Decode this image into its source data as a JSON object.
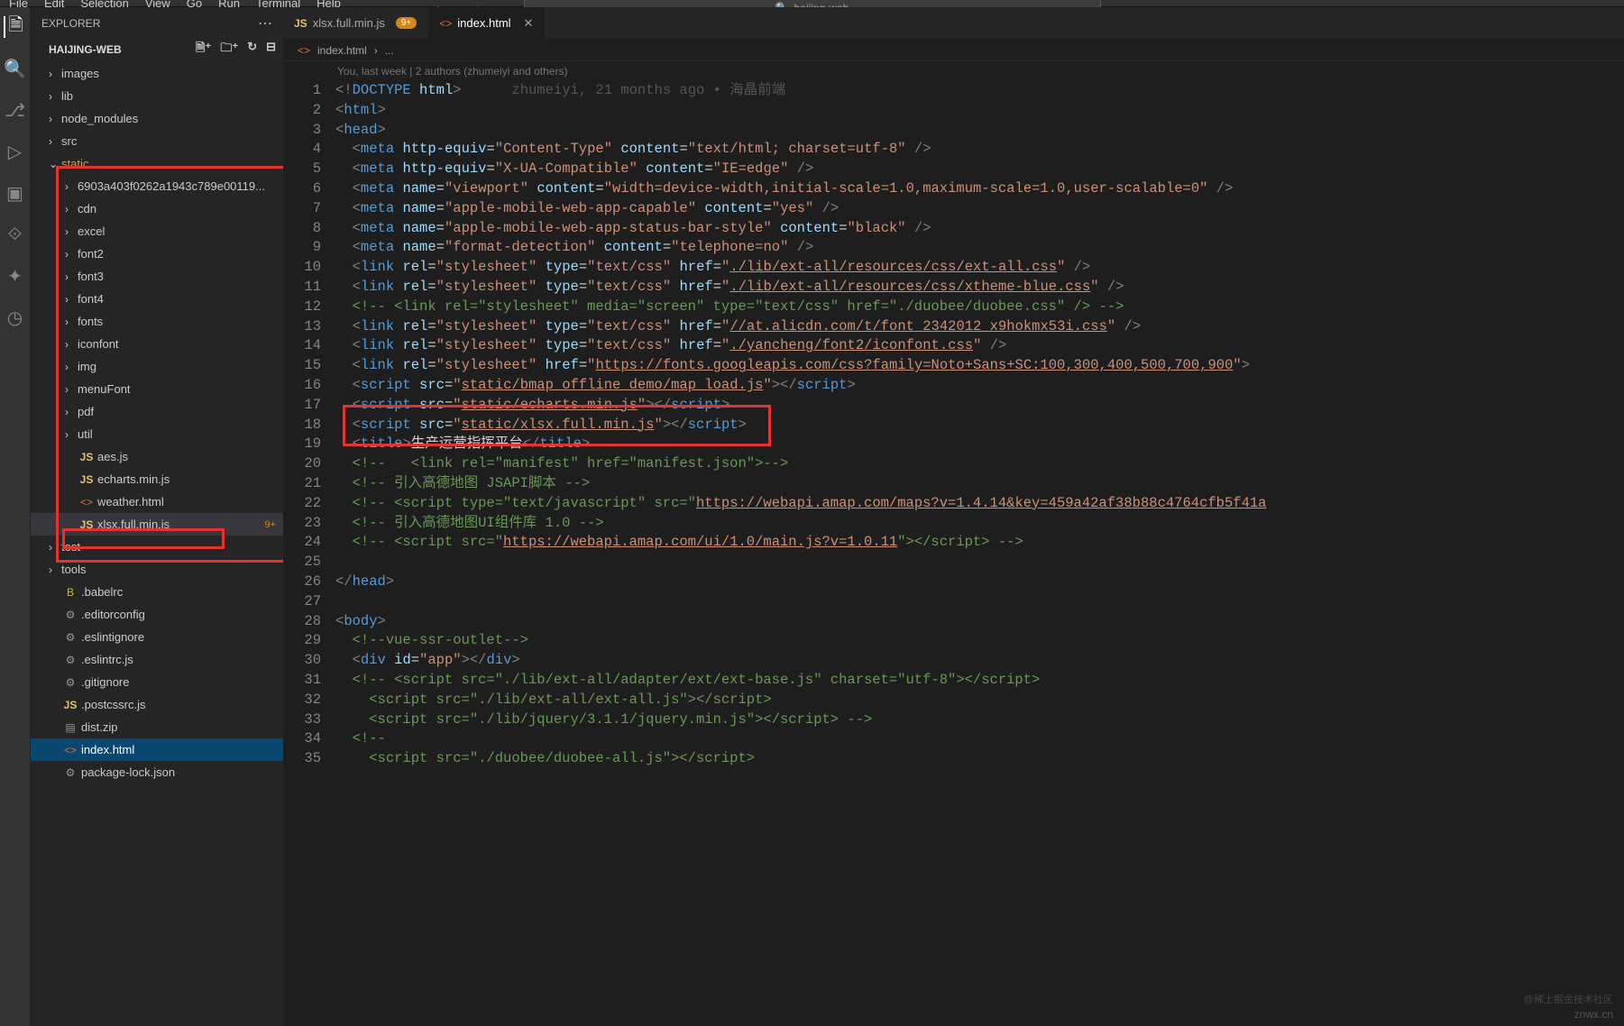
{
  "menubar": {
    "items": [
      "File",
      "Edit",
      "Selection",
      "View",
      "Go",
      "Run",
      "Terminal",
      "Help"
    ],
    "search_text": "haijing-web"
  },
  "explorer": {
    "title": "EXPLORER",
    "project": "HAIJING-WEB"
  },
  "tree": [
    {
      "type": "folder",
      "label": "images",
      "depth": 1,
      "open": false
    },
    {
      "type": "folder",
      "label": "lib",
      "depth": 1,
      "open": false
    },
    {
      "type": "folder",
      "label": "node_modules",
      "depth": 1,
      "open": false
    },
    {
      "type": "folder",
      "label": "src",
      "depth": 1,
      "open": false
    },
    {
      "type": "folder",
      "label": "static",
      "depth": 1,
      "open": true,
      "orange": true
    },
    {
      "type": "folder",
      "label": "6903a403f0262a1943c789e00119...",
      "depth": 2,
      "open": false
    },
    {
      "type": "folder",
      "label": "cdn",
      "depth": 2,
      "open": false
    },
    {
      "type": "folder",
      "label": "excel",
      "depth": 2,
      "open": false
    },
    {
      "type": "folder",
      "label": "font2",
      "depth": 2,
      "open": false
    },
    {
      "type": "folder",
      "label": "font3",
      "depth": 2,
      "open": false
    },
    {
      "type": "folder",
      "label": "font4",
      "depth": 2,
      "open": false
    },
    {
      "type": "folder",
      "label": "fonts",
      "depth": 2,
      "open": false
    },
    {
      "type": "folder",
      "label": "iconfont",
      "depth": 2,
      "open": false
    },
    {
      "type": "folder",
      "label": "img",
      "depth": 2,
      "open": false
    },
    {
      "type": "folder",
      "label": "menuFont",
      "depth": 2,
      "open": false
    },
    {
      "type": "folder",
      "label": "pdf",
      "depth": 2,
      "open": false
    },
    {
      "type": "folder",
      "label": "util",
      "depth": 2,
      "open": false
    },
    {
      "type": "file",
      "label": "aes.js",
      "depth": 2,
      "icon": "js"
    },
    {
      "type": "file",
      "label": "echarts.min.js",
      "depth": 2,
      "icon": "js"
    },
    {
      "type": "file",
      "label": "weather.html",
      "depth": 2,
      "icon": "html"
    },
    {
      "type": "file",
      "label": "xlsx.full.min.js",
      "depth": 2,
      "icon": "js",
      "badge": "9+",
      "selected": true
    },
    {
      "type": "folder",
      "label": "test",
      "depth": 1,
      "open": false
    },
    {
      "type": "folder",
      "label": "tools",
      "depth": 1,
      "open": false
    },
    {
      "type": "file",
      "label": ".babelrc",
      "depth": 1,
      "icon": "babel"
    },
    {
      "type": "file",
      "label": ".editorconfig",
      "depth": 1,
      "icon": "cfg"
    },
    {
      "type": "file",
      "label": ".eslintignore",
      "depth": 1,
      "icon": "cfg"
    },
    {
      "type": "file",
      "label": ".eslintrc.js",
      "depth": 1,
      "icon": "cfg"
    },
    {
      "type": "file",
      "label": ".gitignore",
      "depth": 1,
      "icon": "cfg"
    },
    {
      "type": "file",
      "label": ".postcssrc.js",
      "depth": 1,
      "icon": "js"
    },
    {
      "type": "file",
      "label": "dist.zip",
      "depth": 1,
      "icon": "zip"
    },
    {
      "type": "file",
      "label": "index.html",
      "depth": 1,
      "icon": "html",
      "focused": true
    },
    {
      "type": "file",
      "label": "package-lock.json",
      "depth": 1,
      "icon": "cfg"
    }
  ],
  "tabs": [
    {
      "icon": "js",
      "label": "xlsx.full.min.js",
      "badge": "9+",
      "active": false
    },
    {
      "icon": "html",
      "label": "index.html",
      "active": true,
      "close": true
    }
  ],
  "breadcrumb": {
    "file": "index.html",
    "rest": "..."
  },
  "blame": "You, last week | 2 authors (zhumeiyi and others)",
  "codelens": "zhumeiyi, 21 months ago • 海晶前端",
  "code_lines": [
    {
      "n": 1,
      "html": "<span class='t-punc'>&lt;!</span><span class='t-tag'>DOCTYPE</span> <span class='t-attr'>html</span><span class='t-punc'>&gt;</span>      <span class='t-dim'>zhumeiyi, 21 months ago • 海晶前端</span>"
    },
    {
      "n": 2,
      "html": "<span class='t-punc'>&lt;</span><span class='t-tag'>html</span><span class='t-punc'>&gt;</span>"
    },
    {
      "n": 3,
      "html": "<span class='t-punc'>&lt;</span><span class='t-tag'>head</span><span class='t-punc'>&gt;</span>"
    },
    {
      "n": 4,
      "html": "  <span class='t-punc'>&lt;</span><span class='t-tag'>meta</span> <span class='t-attr'>http-equiv</span>=<span class='t-str'>\"Content-Type\"</span> <span class='t-attr'>content</span>=<span class='t-str'>\"text/html; charset=utf-8\"</span> <span class='t-punc'>/&gt;</span>"
    },
    {
      "n": 5,
      "html": "  <span class='t-punc'>&lt;</span><span class='t-tag'>meta</span> <span class='t-attr'>http-equiv</span>=<span class='t-str'>\"X-UA-Compatible\"</span> <span class='t-attr'>content</span>=<span class='t-str'>\"IE=edge\"</span> <span class='t-punc'>/&gt;</span>"
    },
    {
      "n": 6,
      "html": "  <span class='t-punc'>&lt;</span><span class='t-tag'>meta</span> <span class='t-attr'>name</span>=<span class='t-str'>\"viewport\"</span> <span class='t-attr'>content</span>=<span class='t-str'>\"width=device-width,initial-scale=1.0,maximum-scale=1.0,user-scalable=0\"</span> <span class='t-punc'>/&gt;</span>"
    },
    {
      "n": 7,
      "html": "  <span class='t-punc'>&lt;</span><span class='t-tag'>meta</span> <span class='t-attr'>name</span>=<span class='t-str'>\"apple-mobile-web-app-capable\"</span> <span class='t-attr'>content</span>=<span class='t-str'>\"yes\"</span> <span class='t-punc'>/&gt;</span>"
    },
    {
      "n": 8,
      "html": "  <span class='t-punc'>&lt;</span><span class='t-tag'>meta</span> <span class='t-attr'>name</span>=<span class='t-str'>\"apple-mobile-web-app-status-bar-style\"</span> <span class='t-attr'>content</span>=<span class='t-str'>\"black\"</span> <span class='t-punc'>/&gt;</span>"
    },
    {
      "n": 9,
      "html": "  <span class='t-punc'>&lt;</span><span class='t-tag'>meta</span> <span class='t-attr'>name</span>=<span class='t-str'>\"format-detection\"</span> <span class='t-attr'>content</span>=<span class='t-str'>\"telephone=no\"</span> <span class='t-punc'>/&gt;</span>"
    },
    {
      "n": 10,
      "html": "  <span class='t-punc'>&lt;</span><span class='t-tag'>link</span> <span class='t-attr'>rel</span>=<span class='t-str'>\"stylesheet\"</span> <span class='t-attr'>type</span>=<span class='t-str'>\"text/css\"</span> <span class='t-attr'>href</span>=<span class='t-str'>\"</span><span class='t-link'>./lib/ext-all/resources/css/ext-all.css</span><span class='t-str'>\"</span> <span class='t-punc'>/&gt;</span>"
    },
    {
      "n": 11,
      "html": "  <span class='t-punc'>&lt;</span><span class='t-tag'>link</span> <span class='t-attr'>rel</span>=<span class='t-str'>\"stylesheet\"</span> <span class='t-attr'>type</span>=<span class='t-str'>\"text/css\"</span> <span class='t-attr'>href</span>=<span class='t-str'>\"</span><span class='t-link'>./lib/ext-all/resources/css/xtheme-blue.css</span><span class='t-str'>\"</span> <span class='t-punc'>/&gt;</span>"
    },
    {
      "n": 12,
      "html": "  <span class='t-comment'>&lt;!-- &lt;link rel=\"stylesheet\" media=\"screen\" type=\"text/css\" href=\"./duobee/duobee.css\" /&gt; --&gt;</span>"
    },
    {
      "n": 13,
      "html": "  <span class='t-punc'>&lt;</span><span class='t-tag'>link</span> <span class='t-attr'>rel</span>=<span class='t-str'>\"stylesheet\"</span> <span class='t-attr'>type</span>=<span class='t-str'>\"text/css\"</span> <span class='t-attr'>href</span>=<span class='t-str'>\"</span><span class='t-link'>//at.alicdn.com/t/font_2342012_x9hokmx53i.css</span><span class='t-str'>\"</span> <span class='t-punc'>/&gt;</span>"
    },
    {
      "n": 14,
      "html": "  <span class='t-punc'>&lt;</span><span class='t-tag'>link</span> <span class='t-attr'>rel</span>=<span class='t-str'>\"stylesheet\"</span> <span class='t-attr'>type</span>=<span class='t-str'>\"text/css\"</span> <span class='t-attr'>href</span>=<span class='t-str'>\"</span><span class='t-link'>./yancheng/font2/iconfont.css</span><span class='t-str'>\"</span> <span class='t-punc'>/&gt;</span>"
    },
    {
      "n": 15,
      "html": "  <span class='t-punc'>&lt;</span><span class='t-tag'>link</span> <span class='t-attr'>rel</span>=<span class='t-str'>\"stylesheet\"</span> <span class='t-attr'>href</span>=<span class='t-str'>\"</span><span class='t-link'>https://fonts.googleapis.com/css?family=Noto+Sans+SC:100,300,400,500,700,900</span><span class='t-str'>\"</span><span class='t-punc'>&gt;</span>"
    },
    {
      "n": 16,
      "html": "  <span class='t-punc'>&lt;</span><span class='t-tag'>script</span> <span class='t-attr'>src</span>=<span class='t-str'>\"</span><span class='t-link'>static/bmap_offline_demo/map_load.js</span><span class='t-str'>\"</span><span class='t-punc'>&gt;&lt;/</span><span class='t-tag'>script</span><span class='t-punc'>&gt;</span>"
    },
    {
      "n": 17,
      "html": "  <span class='t-punc'>&lt;</span><span class='t-tag'>script</span> <span class='t-attr'>src</span>=<span class='t-str'>\"</span><span class='t-link'>static/echarts.min.js</span><span class='t-str'>\"</span><span class='t-punc'>&gt;&lt;/</span><span class='t-tag'>script</span><span class='t-punc'>&gt;</span>"
    },
    {
      "n": 18,
      "html": "  <span class='t-punc'>&lt;</span><span class='t-tag'>script</span> <span class='t-attr'>src</span>=<span class='t-str'>\"</span><span class='t-link'>static/xlsx.full.min.js</span><span class='t-str'>\"</span><span class='t-punc'>&gt;&lt;/</span><span class='t-tag'>script</span><span class='t-punc'>&gt;</span>"
    },
    {
      "n": 19,
      "html": "  <span class='t-punc'>&lt;</span><span class='t-tag'>title</span><span class='t-punc'>&gt;</span>生产运营指挥平台<span class='t-punc'>&lt;/</span><span class='t-tag'>title</span><span class='t-punc'>&gt;</span>"
    },
    {
      "n": 20,
      "html": "  <span class='t-comment'>&lt;!--   &lt;link rel=\"manifest\" href=\"manifest.json\"&gt;--&gt;</span>"
    },
    {
      "n": 21,
      "html": "  <span class='t-comment'>&lt;!-- 引入高德地图 JSAPI脚本 --&gt;</span>"
    },
    {
      "n": 22,
      "html": "  <span class='t-comment'>&lt;!-- &lt;script type=\"text/javascript\" src=\"<span class='t-link'>https://webapi.amap.com/maps?v=1.4.14&amp;key=459a42af38b88c4764cfb5f41a</span></span>"
    },
    {
      "n": 23,
      "html": "  <span class='t-comment'>&lt;!-- 引入高德地图UI组件库 1.0 --&gt;</span>"
    },
    {
      "n": 24,
      "html": "  <span class='t-comment'>&lt;!-- &lt;script src=\"<span class='t-link'>https://webapi.amap.com/ui/1.0/main.js?v=1.0.11</span>\"&gt;&lt;/script&gt; --&gt;</span>"
    },
    {
      "n": 25,
      "html": ""
    },
    {
      "n": 26,
      "html": "<span class='t-punc'>&lt;/</span><span class='t-tag'>head</span><span class='t-punc'>&gt;</span>"
    },
    {
      "n": 27,
      "html": ""
    },
    {
      "n": 28,
      "html": "<span class='t-punc'>&lt;</span><span class='t-tag'>body</span><span class='t-punc'>&gt;</span>"
    },
    {
      "n": 29,
      "html": "  <span class='t-comment'>&lt;!--vue-ssr-outlet--&gt;</span>"
    },
    {
      "n": 30,
      "html": "  <span class='t-punc'>&lt;</span><span class='t-tag'>div</span> <span class='t-attr'>id</span>=<span class='t-str'>\"app\"</span><span class='t-punc'>&gt;&lt;/</span><span class='t-tag'>div</span><span class='t-punc'>&gt;</span>"
    },
    {
      "n": 31,
      "html": "  <span class='t-comment'>&lt;!-- &lt;script src=\"./lib/ext-all/adapter/ext/ext-base.js\" charset=\"utf-8\"&gt;&lt;/script&gt;</span>"
    },
    {
      "n": 32,
      "html": "    <span class='t-comment'>&lt;script src=\"./lib/ext-all/ext-all.js\"&gt;&lt;/script&gt;</span>"
    },
    {
      "n": 33,
      "html": "    <span class='t-comment'>&lt;script src=\"./lib/jquery/3.1.1/jquery.min.js\"&gt;&lt;/script&gt; --&gt;</span>"
    },
    {
      "n": 34,
      "html": "  <span class='t-comment'>&lt;!--</span>"
    },
    {
      "n": 35,
      "html": "    <span class='t-comment'>&lt;script src=\"./duobee/duobee-all.js\"&gt;&lt;/script&gt;</span>"
    }
  ],
  "watermark": "znwx.cn",
  "watermark_top": "@稀土掘金技术社区"
}
